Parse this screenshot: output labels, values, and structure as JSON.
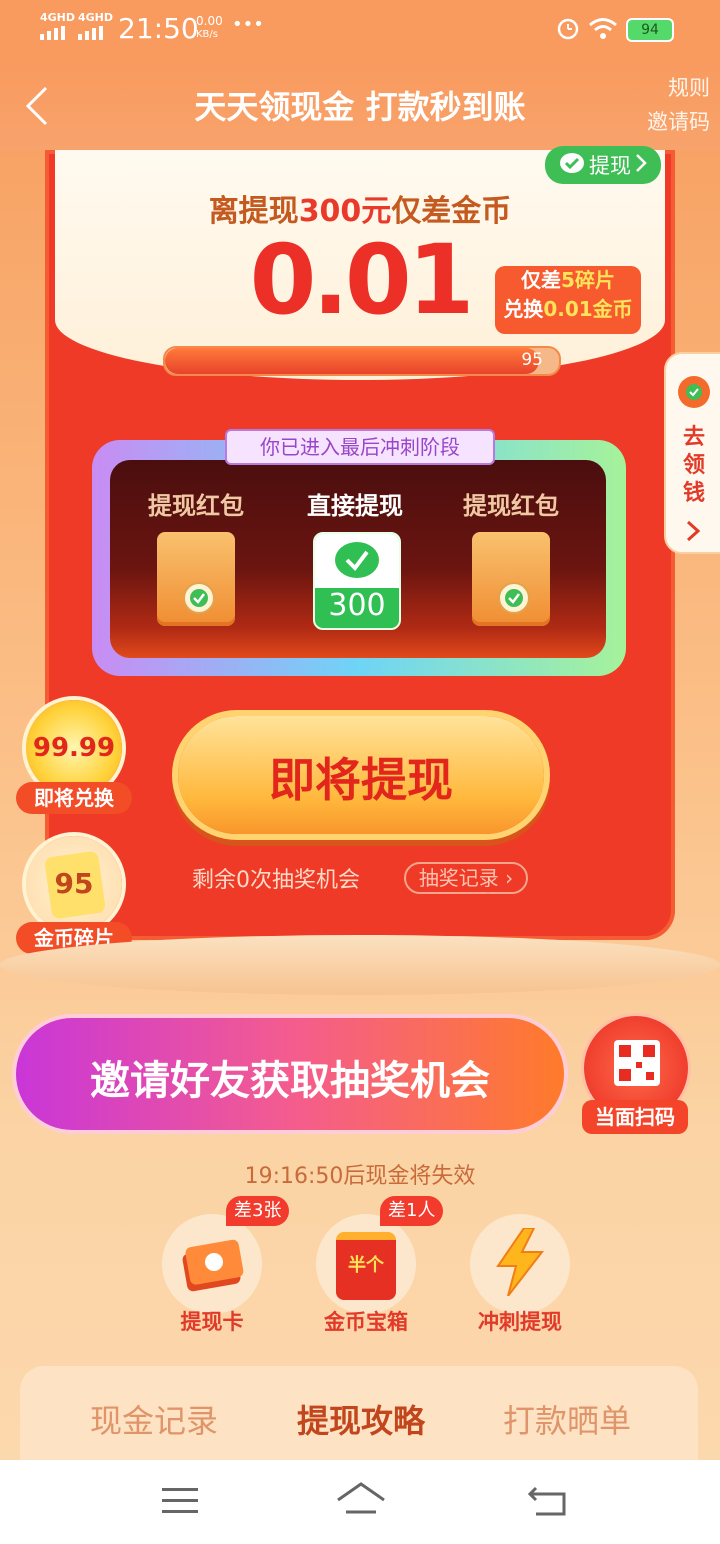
{
  "status": {
    "sig1": "4GHD",
    "sig2": "4GHD",
    "time": "21:50",
    "speed_value": "0.00",
    "speed_unit": "KB/s",
    "more": "•••",
    "battery": "94"
  },
  "nav": {
    "title": "天天领现金 打款秒到账",
    "rules": "规则",
    "invite_code": "邀请码"
  },
  "card": {
    "withdraw_tag": "提现",
    "headline_prefix": "离提现",
    "headline_amount": "300元",
    "headline_suffix": "仅差金币",
    "remaining_coins": "0.01",
    "badge_line1_prefix": "仅差",
    "badge_line1_value": "5碎片",
    "badge_line2_prefix": "兑换",
    "badge_line2_value": "0.01金币",
    "progress_value": "95",
    "progress_fraction": 0.95
  },
  "stage": {
    "tag": "你已进入最后冲刺阶段",
    "left_label": "提现红包",
    "mid_label": "直接提现",
    "right_label": "提现红包",
    "mid_value": "300"
  },
  "side": {
    "tab_text": [
      "去",
      "领",
      "钱"
    ],
    "coin1_value": "99.99",
    "coin1_label": "即将兑换",
    "coin2_value": "95",
    "coin2_label": "金币碎片"
  },
  "action": {
    "draw_button": "即将提现",
    "remaining_text": "剩余0次抽奖机会",
    "record_link": "抽奖记录"
  },
  "invite": {
    "button": "邀请好友获取抽奖机会",
    "qr_label": "当面扫码",
    "expire_text": "19:16:50后现金将失效"
  },
  "features": [
    {
      "label": "提现卡",
      "chip": "差3张"
    },
    {
      "label": "金币宝箱",
      "chip": "差1人",
      "box_text": "半个"
    },
    {
      "label": "冲刺提现"
    }
  ],
  "tabs": [
    "现金记录",
    "提现攻略",
    "打款晒单"
  ],
  "colors": {
    "accent_red": "#ee3a26",
    "wechat_green": "#3fbe55",
    "header_orange": "#f99a5e"
  }
}
